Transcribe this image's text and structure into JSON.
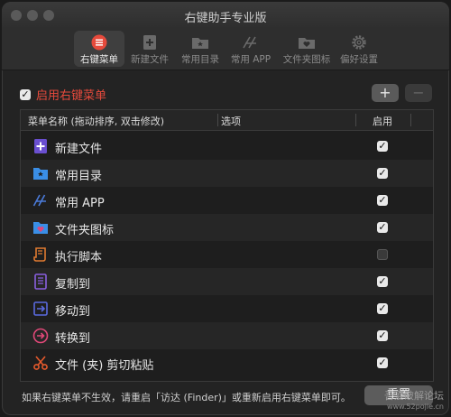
{
  "window": {
    "title": "右键助手专业版"
  },
  "toolbar": {
    "items": [
      {
        "label": "右键菜单",
        "icon": "menu-list-icon",
        "active": true
      },
      {
        "label": "新建文件",
        "icon": "new-file-icon",
        "active": false
      },
      {
        "label": "常用目录",
        "icon": "folder-icon",
        "active": false
      },
      {
        "label": "常用 APP",
        "icon": "app-icon",
        "active": false
      },
      {
        "label": "文件夹图标",
        "icon": "folder-heart-icon",
        "active": false
      },
      {
        "label": "偏好设置",
        "icon": "gear-icon",
        "active": false
      }
    ]
  },
  "enable": {
    "label": "启用右键菜单",
    "checked": true
  },
  "buttons": {
    "add": "+",
    "remove": "−"
  },
  "table": {
    "headers": {
      "name": "菜单名称 (拖动排序, 双击修改)",
      "options": "选项",
      "enabled": "启用"
    },
    "rows": [
      {
        "label": "新建文件",
        "icon": "new-file-icon",
        "enabled": true
      },
      {
        "label": "常用目录",
        "icon": "folder-icon",
        "enabled": true
      },
      {
        "label": "常用 APP",
        "icon": "app-icon",
        "enabled": true
      },
      {
        "label": "文件夹图标",
        "icon": "folder-heart-icon",
        "enabled": true
      },
      {
        "label": "执行脚本",
        "icon": "script-icon",
        "enabled": false
      },
      {
        "label": "复制到",
        "icon": "copy-icon",
        "enabled": true
      },
      {
        "label": "移动到",
        "icon": "move-icon",
        "enabled": true
      },
      {
        "label": "转换到",
        "icon": "convert-icon",
        "enabled": true
      },
      {
        "label": "文件 (夹) 剪切粘贴",
        "icon": "scissors-icon",
        "enabled": true
      }
    ]
  },
  "footer": {
    "hint": "如果右键菜单不生效，请重启「访达 (Finder)」或重新启用右键菜单即可。",
    "reset_label": "重置"
  },
  "watermark": {
    "line1": "吾爱破解论坛",
    "line2": "www.52pojie.cn"
  },
  "colors": {
    "accent": "#e64a3c",
    "folder": "#3a8ee6",
    "purple": "#6a4fd0"
  }
}
